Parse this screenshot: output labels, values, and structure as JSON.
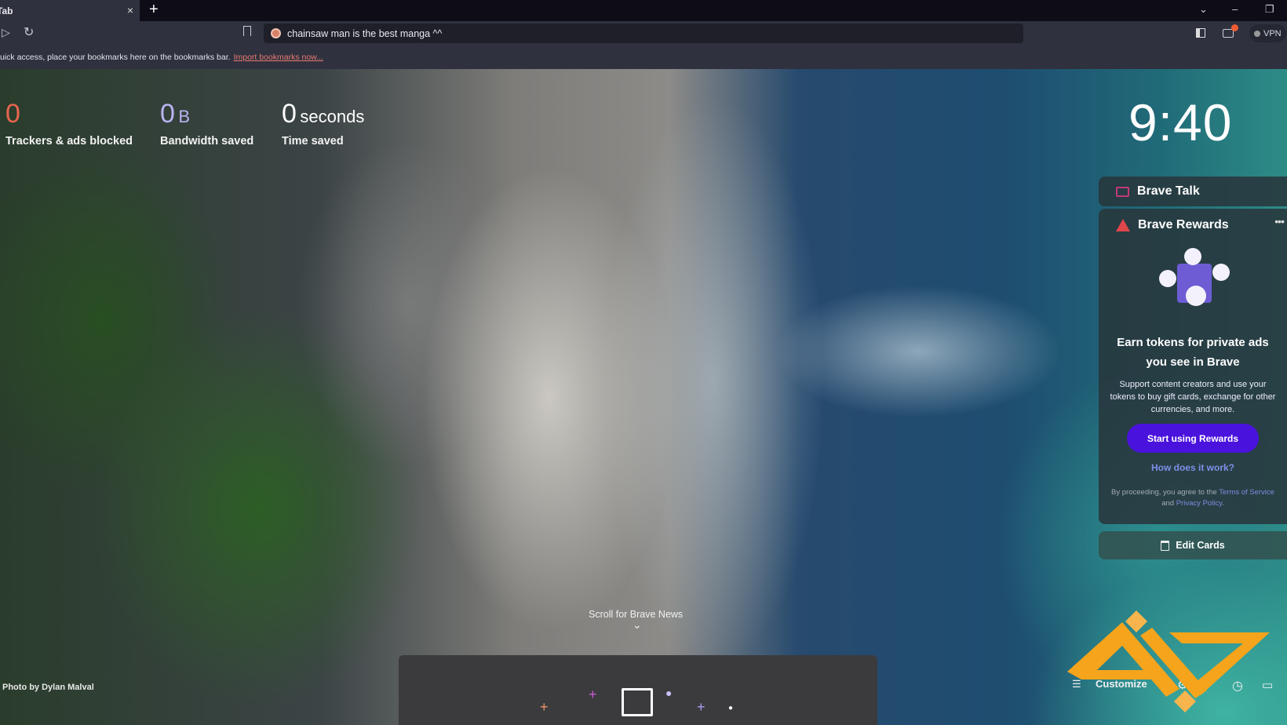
{
  "tabs": [
    {
      "title": "Tab",
      "close": "×"
    }
  ],
  "new_tab_label": "+",
  "window_controls": {
    "dropdown": "⌄",
    "minimize": "–",
    "restore": "❐"
  },
  "toolbar": {
    "forward_icon": "▷",
    "reload_icon": "↻",
    "address_value": "chainsaw man is the best manga ^^",
    "vpn_label": "VPN"
  },
  "bookmarks_bar": {
    "message": "uick access, place your bookmarks here on the bookmarks bar.",
    "import_link": "Import bookmarks now..."
  },
  "stats": [
    {
      "value": "0",
      "unit": "",
      "label": "Trackers & ads blocked",
      "color": "#e8664f"
    },
    {
      "value": "0",
      "unit": "B",
      "label": "Bandwidth saved",
      "color": "#b9b3f2"
    },
    {
      "value": "0",
      "unit": "seconds",
      "label": "Time saved",
      "color": "#ffffff"
    }
  ],
  "clock": "9:40",
  "cards": {
    "talk_title": "Brave Talk",
    "rewards": {
      "title": "Brave Rewards",
      "more": "•••",
      "headline": "Earn tokens for private ads you see in Brave",
      "description": "Support content creators and use your tokens to buy gift cards, exchange for other currencies, and more.",
      "cta": "Start using Rewards",
      "how_link": "How does it work?",
      "legal_prefix": "By proceeding, you agree to the ",
      "terms_link": "Terms of Service",
      "legal_and": " and ",
      "privacy_link": "Privacy Policy",
      "legal_suffix": "."
    },
    "edit_cards": "Edit Cards"
  },
  "news": {
    "label": "Scroll for Brave News",
    "chevron": "⌄"
  },
  "photo_credit": {
    "prefix": "Photo by ",
    "author": "Dylan Malval"
  },
  "bottom_controls": {
    "customize": "Customize"
  },
  "colors": {
    "accent_button": "#4a12dd",
    "link": "#7c8fe8",
    "logo": "#f6a41c"
  }
}
